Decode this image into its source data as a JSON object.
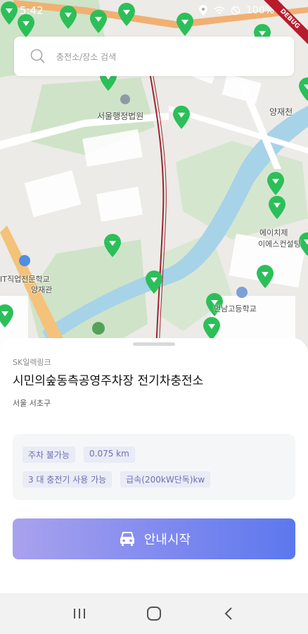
{
  "status_bar": {
    "time": "5:42",
    "battery": "100%",
    "debug_label": "DEBUG"
  },
  "search": {
    "placeholder": "충전소/장소 검색"
  },
  "map": {
    "labels": {
      "court": "서울행정법원",
      "yangjae_stream": "양재천",
      "hch_consulting_line1": "에이치제",
      "hch_consulting_line2": "이에스컨설팅",
      "school_line1": "IT직업전문학교",
      "school_line2": "양재관",
      "high_school": "언남고등학교"
    }
  },
  "station": {
    "operator": "SK일렉링크",
    "name": "시민의숲동측공영주차장 전기차충전소",
    "address": "서울 서초구",
    "chips": {
      "parking": "주차 불가능",
      "distance": "0.075 km",
      "available": "3 대 충전기 사용 가능",
      "speed": "급속(200kW단독)kw"
    }
  },
  "actions": {
    "start_navigation": "안내시작"
  },
  "colors": {
    "marker_green": "#2cbf59",
    "button_gradient_start": "#a9a2ee",
    "button_gradient_end": "#5c78ee",
    "chip_text": "#6d6fb3"
  },
  "icons": {
    "search": "search-icon",
    "car": "car-icon",
    "nav_recent": "recent-apps-icon",
    "nav_home": "home-icon",
    "nav_back": "back-icon"
  }
}
